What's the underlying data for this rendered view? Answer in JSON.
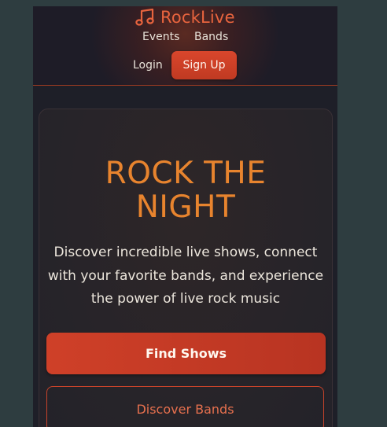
{
  "header": {
    "brand": "RockLive",
    "nav": {
      "events": "Events",
      "bands": "Bands"
    },
    "login_label": "Login",
    "signup_label": "Sign Up"
  },
  "hero": {
    "title_line1": "ROCK THE",
    "title_line2": "NIGHT",
    "subtitle": "Discover incredible live shows, connect with your favorite bands, and experience the power of live rock music",
    "primary_cta": "Find Shows",
    "secondary_cta": "Discover Bands"
  },
  "icons": {
    "logo": "music-note-icon"
  },
  "colors": {
    "accent": "#e8643e",
    "title_orange": "#e8842e",
    "button_red": "#c83c24",
    "background": "#1e1f28"
  }
}
